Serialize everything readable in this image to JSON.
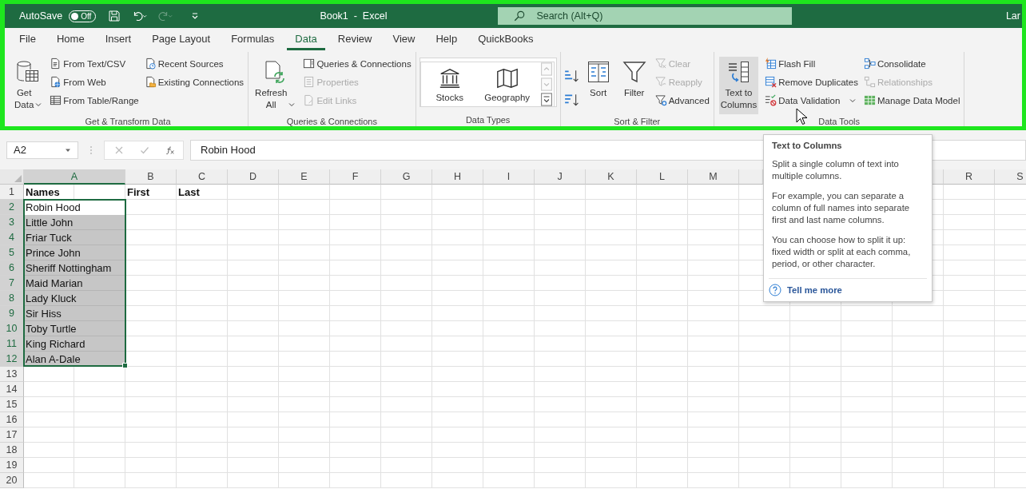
{
  "title_bar": {
    "autosave_label": "AutoSave",
    "autosave": {
      "on": false,
      "label": "Off"
    },
    "redo_disabled": true,
    "title": "Book1  -  Excel",
    "search_placeholder": "Search (Alt+Q)",
    "user": "Lar"
  },
  "tabs": [
    {
      "label": "File",
      "selected": false
    },
    {
      "label": "Home",
      "selected": false
    },
    {
      "label": "Insert",
      "selected": false
    },
    {
      "label": "Page Layout",
      "selected": false
    },
    {
      "label": "Formulas",
      "selected": false
    },
    {
      "label": "Data",
      "selected": true
    },
    {
      "label": "Review",
      "selected": false
    },
    {
      "label": "View",
      "selected": false
    },
    {
      "label": "Help",
      "selected": false
    },
    {
      "label": "QuickBooks",
      "selected": false
    }
  ],
  "ribbon": {
    "groups": [
      {
        "label": "Get & Transform Data",
        "columns": [
          {
            "kind": "large",
            "items": [
              {
                "label": "Get Data",
                "dropdown": true,
                "hovered": false
              }
            ]
          },
          {
            "kind": "stack",
            "items": [
              {
                "label": "From Text/CSV",
                "disabled": false,
                "dropdown": false
              },
              {
                "label": "From Web",
                "disabled": false,
                "dropdown": false
              },
              {
                "label": "From Table/Range",
                "disabled": false,
                "dropdown": false
              }
            ]
          },
          {
            "kind": "stack",
            "items": [
              {
                "label": "Recent Sources",
                "disabled": false,
                "dropdown": false
              },
              {
                "label": "Existing Connections",
                "disabled": false,
                "dropdown": false
              }
            ]
          }
        ]
      },
      {
        "label": "Queries & Connections",
        "columns": [
          {
            "kind": "large",
            "items": [
              {
                "label": "Refresh All",
                "dropdown": true,
                "hovered": false
              }
            ]
          },
          {
            "kind": "stack",
            "items": [
              {
                "label": "Queries & Connections",
                "disabled": false,
                "dropdown": false
              },
              {
                "label": "Properties",
                "disabled": true,
                "dropdown": false
              },
              {
                "label": "Edit Links",
                "disabled": true,
                "dropdown": false
              }
            ]
          }
        ]
      },
      {
        "label": "Data Types",
        "columns": [
          {
            "kind": "gallery",
            "items": [
              {
                "label": "Stocks"
              },
              {
                "label": "Geography"
              }
            ]
          }
        ]
      },
      {
        "label": "Sort & Filter",
        "columns": [
          {
            "kind": "icons",
            "items": [
              {
                "disabled": false
              },
              {
                "disabled": false
              }
            ]
          },
          {
            "kind": "large",
            "items": [
              {
                "label": "Sort",
                "dropdown": false,
                "hovered": false
              }
            ]
          },
          {
            "kind": "large",
            "items": [
              {
                "label": "Filter",
                "dropdown": false,
                "hovered": false
              }
            ]
          },
          {
            "kind": "stack",
            "items": [
              {
                "label": "Clear",
                "disabled": true,
                "dropdown": false
              },
              {
                "label": "Reapply",
                "disabled": true,
                "dropdown": false
              },
              {
                "label": "Advanced",
                "disabled": false,
                "dropdown": false
              }
            ]
          }
        ]
      },
      {
        "label": "Data Tools",
        "columns": [
          {
            "kind": "large",
            "items": [
              {
                "label": "Text to Columns",
                "dropdown": false,
                "hovered": true
              }
            ]
          },
          {
            "kind": "stack",
            "items": [
              {
                "label": "Flash Fill",
                "disabled": false,
                "dropdown": false
              },
              {
                "label": "Remove Duplicates",
                "disabled": false,
                "dropdown": false
              },
              {
                "label": "Data Validation",
                "disabled": false,
                "dropdown": true
              }
            ]
          },
          {
            "kind": "stack",
            "items": [
              {
                "label": "Consolidate",
                "disabled": false,
                "dropdown": false
              },
              {
                "label": "Relationships",
                "disabled": true,
                "dropdown": false
              },
              {
                "label": "Manage Data Model",
                "disabled": false,
                "dropdown": false
              }
            ]
          }
        ]
      }
    ]
  },
  "formula_bar": {
    "name_box": "A2",
    "formula": "Robin Hood"
  },
  "sheet": {
    "columns": [
      {
        "label": "A",
        "selected": true
      },
      {
        "label": "B",
        "selected": false
      },
      {
        "label": "C",
        "selected": false
      },
      {
        "label": "D",
        "selected": false
      },
      {
        "label": "E",
        "selected": false
      },
      {
        "label": "F",
        "selected": false
      },
      {
        "label": "G",
        "selected": false
      },
      {
        "label": "H",
        "selected": false
      },
      {
        "label": "I",
        "selected": false
      },
      {
        "label": "J",
        "selected": false
      },
      {
        "label": "K",
        "selected": false
      },
      {
        "label": "L",
        "selected": false
      },
      {
        "label": "M",
        "selected": false
      },
      {
        "label": "R",
        "selected": false
      },
      {
        "label": "S",
        "selected": false
      }
    ],
    "rows": [
      {
        "header": "1",
        "selected": false,
        "cells": [
          {
            "text": "Names",
            "bold": true,
            "selected": false,
            "active": false
          },
          {
            "text": "First",
            "bold": true,
            "selected": false,
            "active": false
          },
          {
            "text": "Last",
            "bold": true,
            "selected": false,
            "active": false
          }
        ]
      },
      {
        "header": "2",
        "selected": true,
        "cells": [
          {
            "text": "Robin Hood",
            "bold": false,
            "selected": true,
            "active": true
          }
        ]
      },
      {
        "header": "3",
        "selected": true,
        "cells": [
          {
            "text": "Little John",
            "bold": false,
            "selected": true,
            "active": false
          }
        ]
      },
      {
        "header": "4",
        "selected": true,
        "cells": [
          {
            "text": "Friar Tuck",
            "bold": false,
            "selected": true,
            "active": false
          }
        ]
      },
      {
        "header": "5",
        "selected": true,
        "cells": [
          {
            "text": "Prince John",
            "bold": false,
            "selected": true,
            "active": false
          }
        ]
      },
      {
        "header": "6",
        "selected": true,
        "cells": [
          {
            "text": "Sheriff Nottingham",
            "bold": false,
            "selected": true,
            "active": false
          }
        ]
      },
      {
        "header": "7",
        "selected": true,
        "cells": [
          {
            "text": "Maid Marian",
            "bold": false,
            "selected": true,
            "active": false
          }
        ]
      },
      {
        "header": "8",
        "selected": true,
        "cells": [
          {
            "text": "Lady Kluck",
            "bold": false,
            "selected": true,
            "active": false
          }
        ]
      },
      {
        "header": "9",
        "selected": true,
        "cells": [
          {
            "text": "Sir Hiss",
            "bold": false,
            "selected": true,
            "active": false
          }
        ]
      },
      {
        "header": "10",
        "selected": true,
        "cells": [
          {
            "text": "Toby Turtle",
            "bold": false,
            "selected": true,
            "active": false
          }
        ]
      },
      {
        "header": "11",
        "selected": true,
        "cells": [
          {
            "text": "King Richard",
            "bold": false,
            "selected": true,
            "active": false
          }
        ]
      },
      {
        "header": "12",
        "selected": true,
        "cells": [
          {
            "text": "Alan A-Dale",
            "bold": false,
            "selected": true,
            "active": false
          }
        ]
      },
      {
        "header": "13",
        "selected": false
      },
      {
        "header": "14",
        "selected": false
      },
      {
        "header": "15",
        "selected": false
      },
      {
        "header": "16",
        "selected": false
      },
      {
        "header": "17",
        "selected": false
      },
      {
        "header": "18",
        "selected": false
      },
      {
        "header": "19",
        "selected": false
      },
      {
        "header": "20",
        "selected": false
      }
    ]
  },
  "tooltip": {
    "title": "Text to Columns",
    "paragraphs": [
      "Split a single column of text into multiple columns.",
      "For example, you can separate a column of full names into separate first and last name columns.",
      "You can choose how to split it up: fixed width or split at each comma, period, or other character."
    ],
    "link": "Tell me more"
  }
}
